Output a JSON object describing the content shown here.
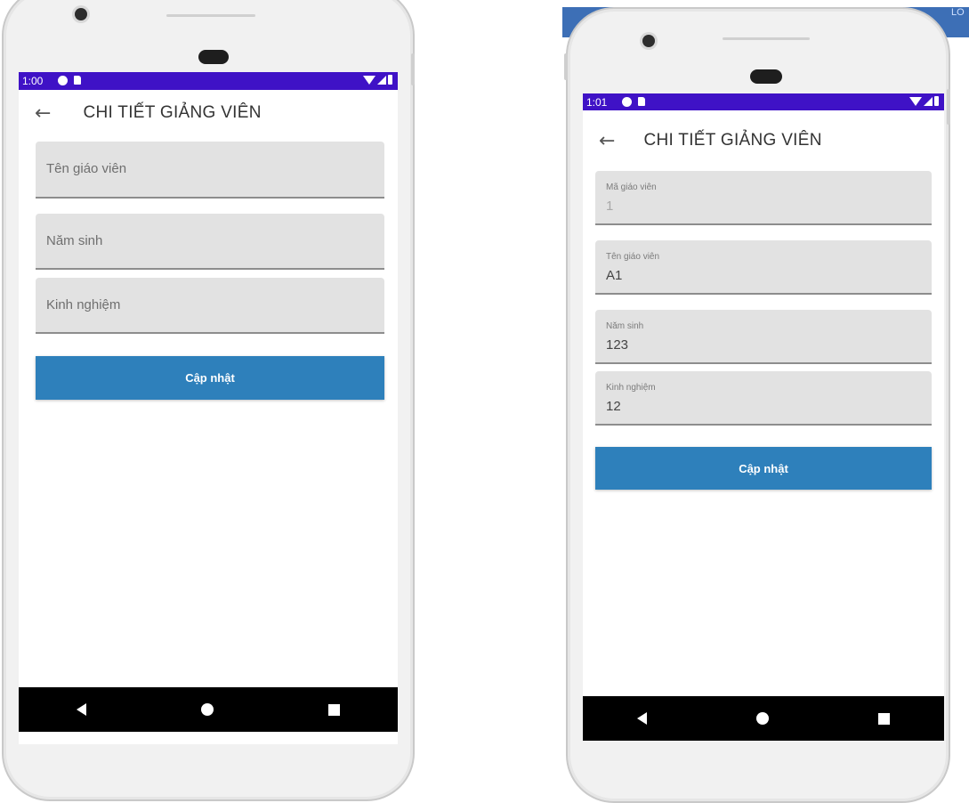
{
  "colors": {
    "status_bar": "#3f12c6",
    "button": "#2e80bb",
    "field_bg": "#e2e2e2",
    "nav_bar": "#000000"
  },
  "left_phone": {
    "status_time": "1:00",
    "app_title": "CHI TIẾT GIẢNG VIÊN",
    "back_icon": "←",
    "fields": [
      {
        "placeholder": "Tên giáo viên"
      },
      {
        "placeholder": "Năm sinh"
      },
      {
        "placeholder": "Kinh nghiệm"
      }
    ],
    "update_button": "Cập nhật"
  },
  "right_phone": {
    "status_time": "1:01",
    "app_title": "CHI TIẾT GIẢNG VIÊN",
    "back_icon": "←",
    "fields": [
      {
        "label": "Mã giáo viên",
        "value": "1",
        "disabled": true
      },
      {
        "label": "Tên giáo viên",
        "value": "A1"
      },
      {
        "label": "Năm sinh",
        "value": "123"
      },
      {
        "label": "Kinh nghiệm",
        "value": "12"
      }
    ],
    "update_button": "Cập nhật"
  },
  "background_window": {
    "corner_text": "LO"
  },
  "icons": [
    "back-arrow-icon",
    "wifi-icon",
    "signal-icon",
    "battery-icon",
    "nav-back-icon",
    "nav-home-icon",
    "nav-recents-icon"
  ]
}
